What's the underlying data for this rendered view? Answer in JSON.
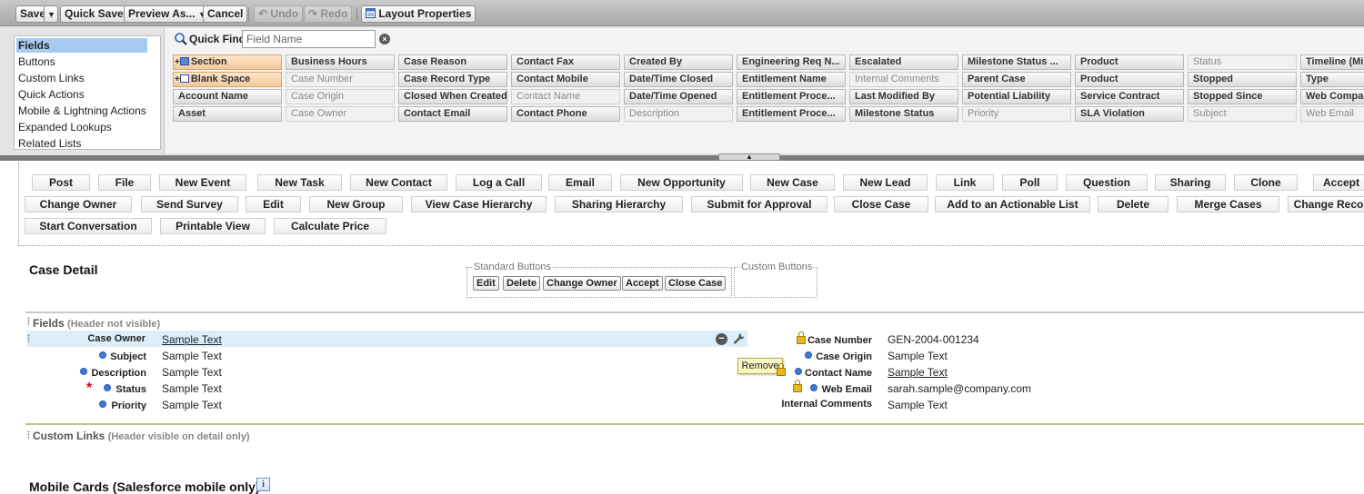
{
  "toolbar": {
    "save": "Save",
    "quick_save": "Quick Save",
    "preview_as": "Preview As...",
    "cancel": "Cancel",
    "undo": "Undo",
    "redo": "Redo",
    "layout_properties": "Layout Properties"
  },
  "palette": {
    "categories": [
      "Fields",
      "Buttons",
      "Custom Links",
      "Quick Actions",
      "Mobile & Lightning Actions",
      "Expanded Lookups",
      "Related Lists"
    ],
    "selected_category": "Fields",
    "quick_find_label": "Quick Find",
    "quick_find_placeholder": "Field Name",
    "field_columns": [
      [
        "Section",
        "Blank Space",
        "Account Name",
        "Asset"
      ],
      [
        "Business Hours",
        "Case Number",
        "Case Origin",
        "Case Owner"
      ],
      [
        "Case Reason",
        "Case Record Type",
        "Closed When Created",
        "Contact Email"
      ],
      [
        "Contact Fax",
        "Contact Mobile",
        "Contact Name",
        "Contact Phone"
      ],
      [
        "Created By",
        "Date/Time Closed",
        "Date/Time Opened",
        "Description"
      ],
      [
        "Engineering Req N...",
        "Entitlement Name",
        "Entitlement Proce...",
        "Entitlement Proce..."
      ],
      [
        "Escalated",
        "Internal Comments",
        "Last Modified By",
        "Milestone Status"
      ],
      [
        "Milestone Status ...",
        "Parent Case",
        "Potential Liability",
        "Priority"
      ],
      [
        "Product",
        "Product",
        "Service Contract",
        "SLA Violation"
      ],
      [
        "Status",
        "Stopped",
        "Stopped Since",
        "Subject"
      ],
      [
        "Timeline (Minu",
        "Type",
        "Web Company",
        "Web Email"
      ]
    ],
    "used_fields": [
      "Case Number",
      "Case Origin",
      "Case Owner",
      "Contact Name",
      "Description",
      "Internal Comments",
      "Priority",
      "Status",
      "Subject",
      "Web Email"
    ]
  },
  "action_buttons": {
    "row1": [
      "Post",
      "File",
      "New Event",
      "New Task",
      "New Contact",
      "Log a Call",
      "Email",
      "New Opportunity",
      "New Case",
      "New Lead",
      "Link",
      "Poll",
      "Question",
      "Sharing",
      "Clone",
      "Accept"
    ],
    "row2": [
      "Change Owner",
      "Send Survey",
      "Edit",
      "New Group",
      "View Case Hierarchy",
      "Sharing Hierarchy",
      "Submit for Approval",
      "Close Case",
      "Add to an Actionable List",
      "Delete",
      "Merge Cases",
      "Change Reco"
    ],
    "row3": [
      "Start Conversation",
      "Printable View",
      "Calculate Price"
    ]
  },
  "case_detail": {
    "title": "Case Detail",
    "standard_buttons_label": "Standard Buttons",
    "standard_buttons": [
      "Edit",
      "Delete",
      "Change Owner",
      "Accept",
      "Close Case"
    ],
    "custom_buttons_label": "Custom Buttons"
  },
  "fields_section": {
    "title": "Fields",
    "note": "(Header not visible)",
    "left": [
      {
        "label": "Case Owner",
        "value": "Sample Text"
      },
      {
        "label": "Subject",
        "value": "Sample Text"
      },
      {
        "label": "Description",
        "value": "Sample Text"
      },
      {
        "label": "Status",
        "value": "Sample Text"
      },
      {
        "label": "Priority",
        "value": "Sample Text"
      }
    ],
    "right": [
      {
        "label": "Case Number",
        "value": "GEN-2004-001234"
      },
      {
        "label": "Case Origin",
        "value": "Sample Text"
      },
      {
        "label": "Contact Name",
        "value": "Sample Text"
      },
      {
        "label": "Web Email",
        "value": "sarah.sample@company.com"
      },
      {
        "label": "Internal Comments",
        "value": "Sample Text"
      }
    ],
    "tooltip": "Remove"
  },
  "custom_links_section": {
    "title": "Custom Links",
    "note": "(Header visible on detail only)"
  },
  "mobile_cards": {
    "title": "Mobile Cards (Salesforce mobile only)",
    "info_glyph": "i"
  },
  "colors": {
    "selected_category": "#a6cbf0",
    "row_highlight": "#ddeefa",
    "required": "#d0021b",
    "tooltip_bg": "#fbf7c4",
    "fields_rule": "#c8c8c8",
    "custom_links_rule": "#c7c28a"
  }
}
